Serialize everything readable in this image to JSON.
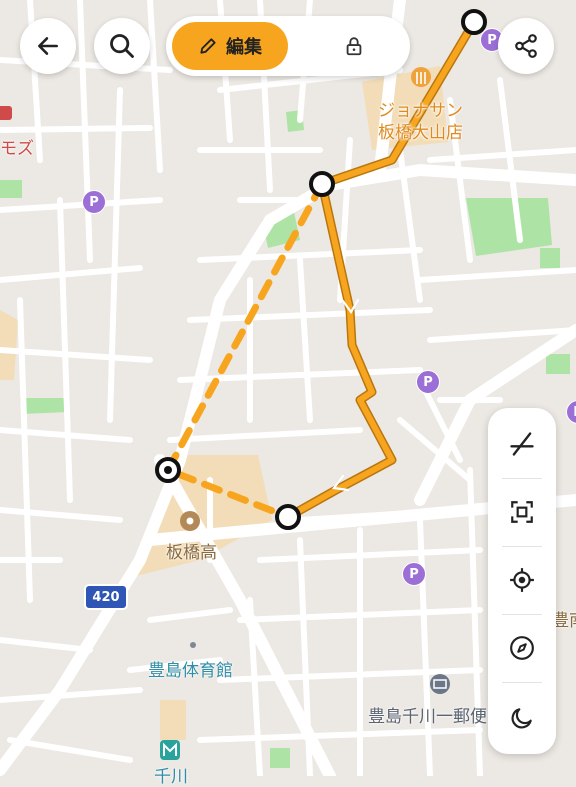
{
  "toolbar_top": {
    "edit_label": "編集",
    "icons": [
      "back-arrow-icon",
      "search-icon",
      "pencil-icon",
      "lock-icon",
      "share-icon"
    ]
  },
  "side_tools": {
    "icons": [
      "pencil-off-icon",
      "fit-bounds-icon",
      "my-location-icon",
      "compass-icon",
      "dark-mode-icon"
    ]
  },
  "map_labels": {
    "restaurant": "ジョナサン",
    "restaurant_sub": "板橋大山店",
    "left_edge": "モズ",
    "school": "板橋高",
    "gym": "豊島体育館",
    "post_office": "豊島千川一郵便",
    "station_partial": "千川",
    "right_edge": "豊南",
    "route_shield": "420",
    "parking": "P"
  },
  "colors": {
    "route": "#f7a51e",
    "route_outline": "#b8760e",
    "park": "#aee3a6",
    "school_area": "#f2ddb8",
    "road": "#ffffff",
    "background": "#ece8e3"
  }
}
